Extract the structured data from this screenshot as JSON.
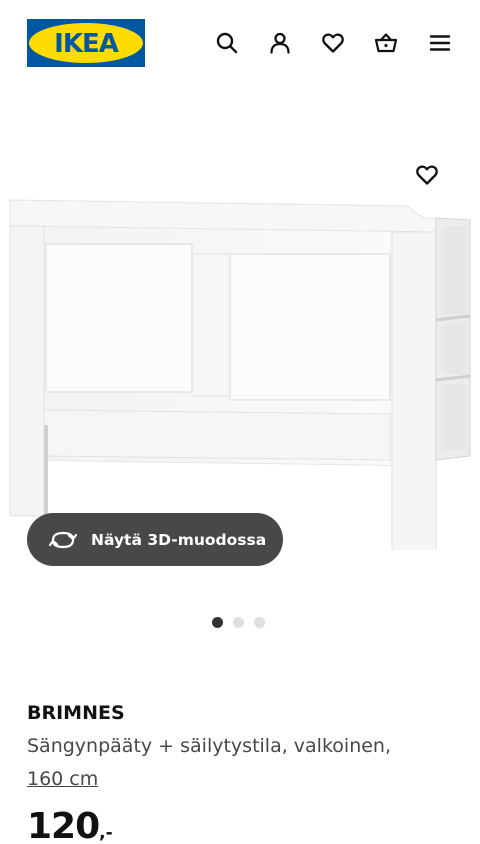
{
  "header": {
    "logo_text": "IKEA",
    "icons": [
      "search-icon",
      "account-icon",
      "heart-icon",
      "cart-icon",
      "menu-icon"
    ]
  },
  "gallery": {
    "view_3d_label": "Näytä 3D-muodossa",
    "dots": 3,
    "active_dot": 1
  },
  "product": {
    "name": "BRIMNES",
    "description": "Sängynpääty + säilytystila, valkoinen,",
    "size": "160 cm",
    "price_integer": "120",
    "price_suffix": ",-"
  },
  "colors": {
    "brand_blue": "#0058a3",
    "brand_yellow": "#ffdb00",
    "button_dark": "#484848"
  }
}
